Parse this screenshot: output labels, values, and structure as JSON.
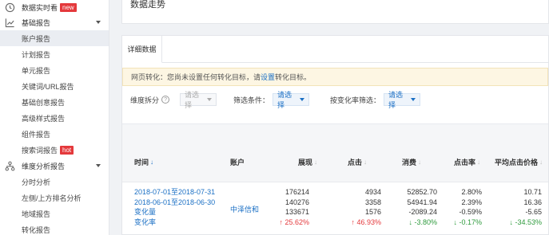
{
  "sidebar": {
    "realtime": {
      "label": "数据实时看",
      "badge": "new"
    },
    "basic_report": {
      "label": "基础报告",
      "items": [
        {
          "label": "账户报告",
          "active": true
        },
        {
          "label": "计划报告"
        },
        {
          "label": "单元报告"
        },
        {
          "label": "关键词/URL报告"
        },
        {
          "label": "基础创意报告"
        },
        {
          "label": "高级样式报告"
        },
        {
          "label": "组件报告"
        },
        {
          "label": "搜索词报告",
          "badge": "hot"
        }
      ]
    },
    "dimension_report": {
      "label": "维度分析报告",
      "items": [
        {
          "label": "分时分析"
        },
        {
          "label": "左侧/上方排名分析"
        },
        {
          "label": "地域报告"
        },
        {
          "label": "转化报告"
        }
      ]
    }
  },
  "trend": {
    "title": "数据走势"
  },
  "detail": {
    "tab": "详细数据",
    "notice": {
      "prefix": "网页转化：您尚未设置任何转化目标，请",
      "link": "设置",
      "suffix": "转化目标。"
    },
    "filters": {
      "dimension_label": "维度拆分",
      "dimension_value": "请选择",
      "condition_label": "筛选条件：",
      "condition_value": "请选择",
      "change_label": "按变化率筛选：",
      "change_value": "请选择"
    },
    "columns": {
      "time": "时间",
      "account": "账户",
      "impressions": "展现",
      "clicks": "点击",
      "cost": "消费",
      "ctr": "点击率",
      "avg_cpc": "平均点击价格"
    },
    "row": {
      "time": [
        "2018-07-01至2018-07-31",
        "2018-06-01至2018-06-30",
        "变化量",
        "变化率"
      ],
      "account": "中泽信和",
      "impressions": [
        "176214",
        "140276",
        "133671",
        "25.62%"
      ],
      "clicks": [
        "4934",
        "3358",
        "1576",
        "46.93%"
      ],
      "cost": [
        "52852.70",
        "54941.94",
        "-2089.24",
        "-3.80%"
      ],
      "ctr": [
        "2.80%",
        "2.39%",
        "-0.59%",
        "-0.17%"
      ],
      "avg_cpc": [
        "10.71",
        "16.36",
        "-5.65",
        "-34.53%"
      ],
      "rate_direction": {
        "impressions": "up",
        "clicks": "up",
        "cost": "down",
        "ctr": "down",
        "avg_cpc": "down"
      }
    }
  },
  "colors": {
    "accent": "#1a6fc4",
    "up": "#e4393c",
    "down": "#2e9a3c",
    "badge": "#e4393c"
  }
}
